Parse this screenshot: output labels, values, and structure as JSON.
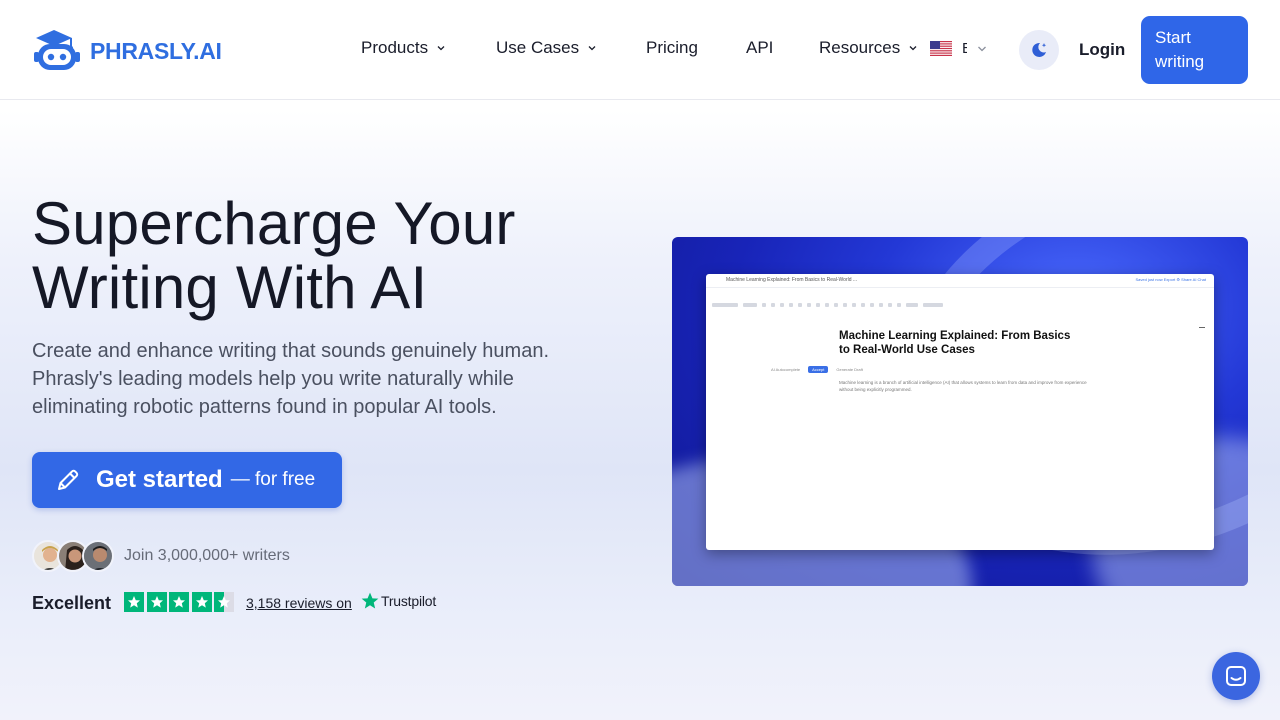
{
  "brand": {
    "name": "PHRASLY.AI",
    "color": "#2f6ee0",
    "logo_icon": "robot-graduation-cap-icon"
  },
  "nav": {
    "items": [
      {
        "label": "Products",
        "has_dropdown": true
      },
      {
        "label": "Use Cases",
        "has_dropdown": true
      },
      {
        "label": "Pricing",
        "has_dropdown": false
      },
      {
        "label": "API",
        "has_dropdown": false
      },
      {
        "label": "Resources",
        "has_dropdown": true
      }
    ],
    "language": {
      "flag": "us-flag-icon",
      "code": "E"
    },
    "theme_icon": "moon-sparkle-icon",
    "login_label": "Login",
    "start_label": "Start writing",
    "accent": "#2f66e8"
  },
  "hero": {
    "title": "Supercharge Your Writing With AI",
    "subtitle": "Create and enhance writing that sounds genuinely human. Phrasly's leading models help you write naturally while eliminating robotic patterns found in popular AI tools.",
    "cta_main": "Get started",
    "cta_sub": "— for free",
    "cta_icon": "pencil-icon",
    "join_text": "Join 3,000,000+ writers",
    "rating_word": "Excellent",
    "stars": 4.5,
    "reviews_text": "3,158 reviews on",
    "trustpilot_label": "Trustpilot",
    "trustpilot_color": "#00b67a"
  },
  "editor_preview": {
    "doc_name": "Machine Learning Explained: From Basics to Real-World ...",
    "doc_actions": "Saved just now   Export   ⚙   Share   AI Chat",
    "doc_title": "Machine Learning Explained: From Basics to Real-World Use Cases",
    "chips": [
      "AI Autocomplete",
      "Accept",
      "Generate Draft"
    ],
    "body_text": "Machine learning is a branch of artificial intelligence (AI) that allows systems to learn from data and improve from experience without being explicitly programmed."
  },
  "chat": {
    "icon": "chat-bubble-icon"
  }
}
